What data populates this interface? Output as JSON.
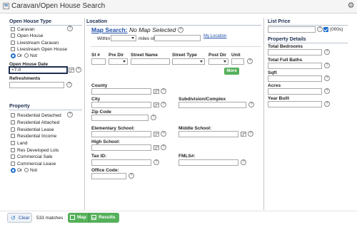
{
  "title": "Caravan/Open House Search",
  "open_house_type": {
    "header": "Open House Type",
    "options": [
      "Caravan",
      "Open House",
      "Livestream Caravan",
      "Livestream Open House"
    ],
    "or_label": "Or",
    "not_label": "Not"
  },
  "open_house_date": {
    "label": "Open House Date",
    "value": "+7-0"
  },
  "refreshments": {
    "label": "Refreshments"
  },
  "property": {
    "header": "Property",
    "options": [
      "Residential Detached",
      "Residential Attached",
      "Residential Lease",
      "Residential Income",
      "Land",
      "Res Developed Lots",
      "Commercial Sale",
      "Commercial Lease"
    ],
    "or_label": "Or",
    "not_label": "Not"
  },
  "location": {
    "header": "Location",
    "map_search_label": "Map Search:",
    "map_status": "No Map Selected",
    "within_label": "Within",
    "miles_of_label": "miles of",
    "my_location_label": "My Location",
    "street_cols": [
      "St #",
      "Pre Dir",
      "Street Name",
      "Street Type",
      "Post Dir",
      "Unit"
    ],
    "more_label": "More",
    "county_label": "County",
    "city_label": "City",
    "subdivision_label": "Subdivision/Complex",
    "zip_label": "Zip Code",
    "elementary_label": "Elementary School:",
    "middle_label": "Middle School:",
    "high_label": "High School:",
    "taxid_label": "Tax ID:",
    "fmls_label": "FMLS#:",
    "office_label": "Office Code:"
  },
  "list_price": {
    "header": "List Price",
    "unit_label": "(000s)",
    "unit_checked": true
  },
  "property_details": {
    "header": "Property Details",
    "fields": [
      "Total Bedrooms",
      "Total Full Baths",
      "Sqft",
      "Acres",
      "Year Built"
    ]
  },
  "footer": {
    "clear_label": "Clear",
    "matches": "533 matches",
    "map_label": "Map",
    "results_label": "Results"
  },
  "colors": {
    "accent": "#1f6fd0",
    "green": "#55b05a",
    "header_text": "#1b2d4f"
  }
}
